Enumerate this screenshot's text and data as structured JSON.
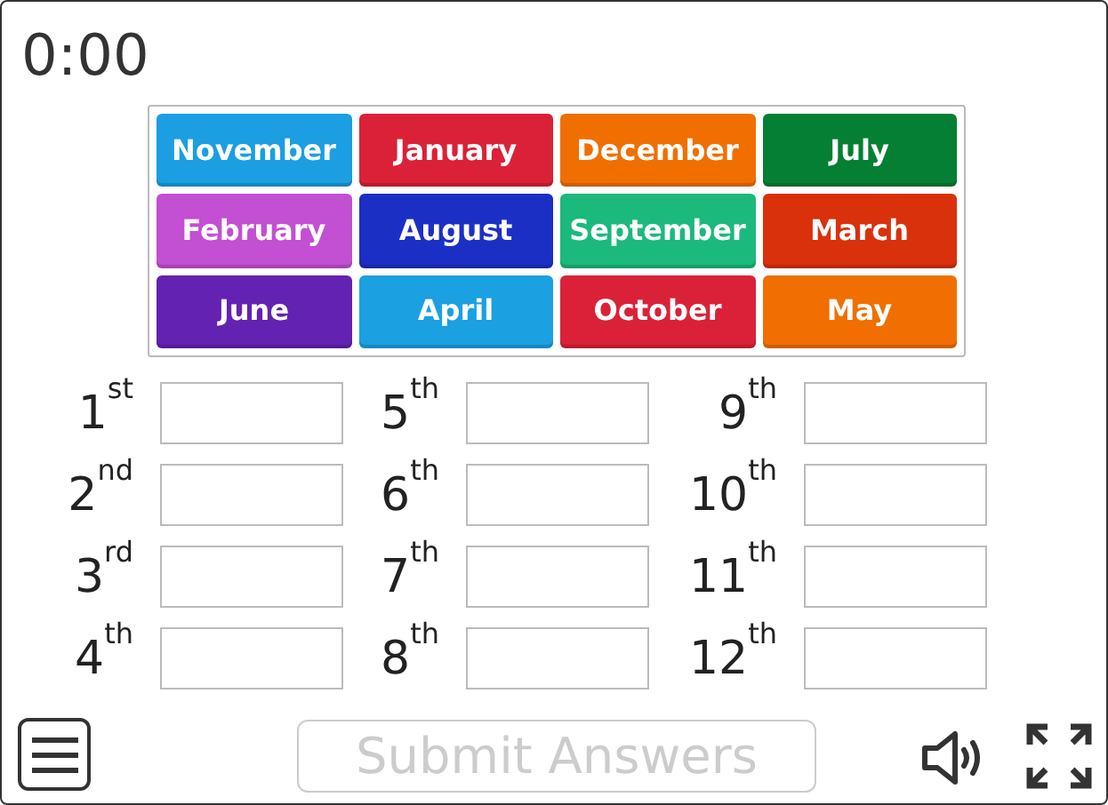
{
  "timer": "0:00",
  "tiles": [
    {
      "label": "November",
      "color": "#1b9ee2"
    },
    {
      "label": "January",
      "color": "#db2138"
    },
    {
      "label": "December",
      "color": "#f06f00"
    },
    {
      "label": "July",
      "color": "#057f33"
    },
    {
      "label": "February",
      "color": "#c34fd2"
    },
    {
      "label": "August",
      "color": "#1c2fc5"
    },
    {
      "label": "September",
      "color": "#1cb97c"
    },
    {
      "label": "March",
      "color": "#d9310b"
    },
    {
      "label": "June",
      "color": "#6422b2"
    },
    {
      "label": "April",
      "color": "#1ba0e2"
    },
    {
      "label": "October",
      "color": "#db2138"
    },
    {
      "label": "May",
      "color": "#f06f00"
    }
  ],
  "answers": [
    {
      "label": "1$^{st}$"
    },
    {
      "label": "5$^{th}$"
    },
    {
      "label": "9$^{th}$"
    },
    {
      "label": "2$^{nd}$"
    },
    {
      "label": "6$^{th}$"
    },
    {
      "label": "10$^{th}$"
    },
    {
      "label": "3$^{rd}$"
    },
    {
      "label": "7$^{th}$"
    },
    {
      "label": "11$^{th}$"
    },
    {
      "label": "4$^{th}$"
    },
    {
      "label": "8$^{th}$"
    },
    {
      "label": "12$^{th}$"
    }
  ],
  "submit": {
    "label": "Submit Answers",
    "disabled": true
  }
}
